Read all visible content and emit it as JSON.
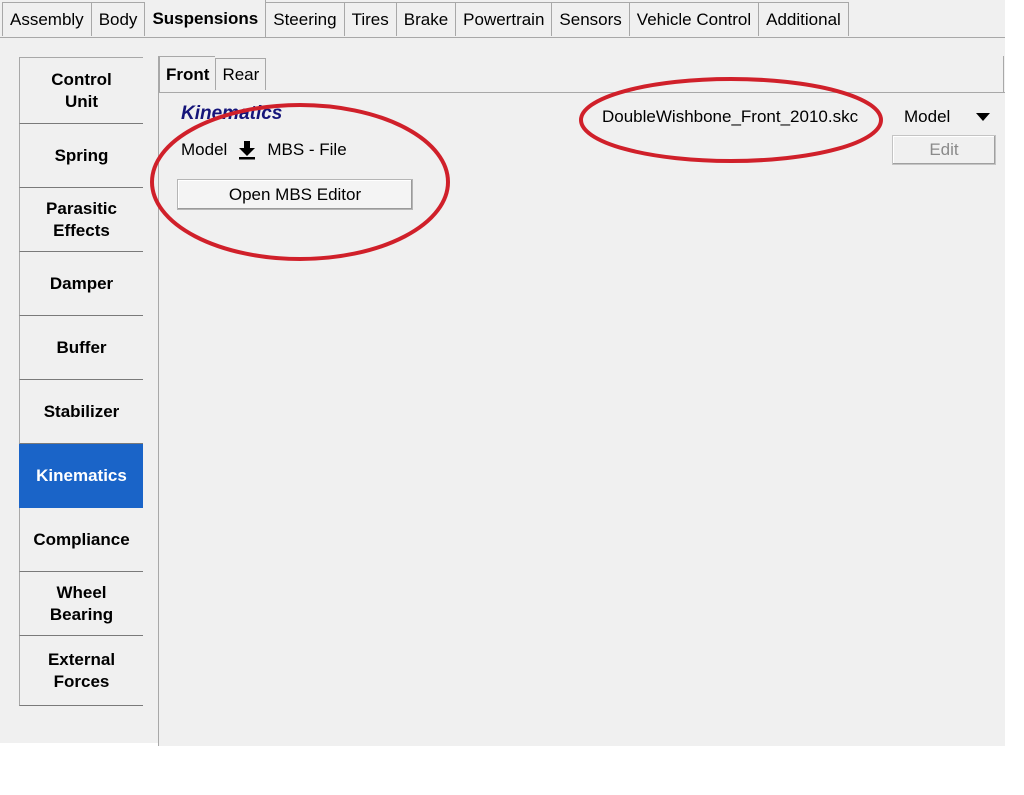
{
  "top_tabs": [
    {
      "label": "Assembly",
      "active": false
    },
    {
      "label": "Body",
      "active": false
    },
    {
      "label": "Suspensions",
      "active": true
    },
    {
      "label": "Steering",
      "active": false
    },
    {
      "label": "Tires",
      "active": false
    },
    {
      "label": "Brake",
      "active": false
    },
    {
      "label": "Powertrain",
      "active": false
    },
    {
      "label": "Sensors",
      "active": false
    },
    {
      "label": "Vehicle Control",
      "active": false
    },
    {
      "label": "Additional",
      "active": false
    }
  ],
  "sidebar": {
    "items": [
      {
        "label": "Control\nUnit",
        "active": false
      },
      {
        "label": "Spring",
        "active": false
      },
      {
        "label": "Parasitic\nEffects",
        "active": false
      },
      {
        "label": "Damper",
        "active": false
      },
      {
        "label": "Buffer",
        "active": false
      },
      {
        "label": "Stabilizer",
        "active": false
      },
      {
        "label": "Kinematics",
        "active": true
      },
      {
        "label": "Compliance",
        "active": false
      },
      {
        "label": "Wheel\nBearing",
        "active": false
      },
      {
        "label": "External\nForces",
        "active": false
      }
    ]
  },
  "sub_tabs": [
    {
      "label": "Front",
      "active": true
    },
    {
      "label": "Rear",
      "active": false
    }
  ],
  "kinematics": {
    "title": "Kinematics",
    "model_label": "Model",
    "model_value": "MBS - File",
    "open_editor_label": "Open MBS Editor",
    "file_name": "DoubleWishbone_Front_2010.skc",
    "model_select_value": "Model",
    "edit_label": "Edit"
  },
  "colors": {
    "active_item": "#1a64c8",
    "title": "#15157a",
    "annotation": "#d0202a"
  }
}
